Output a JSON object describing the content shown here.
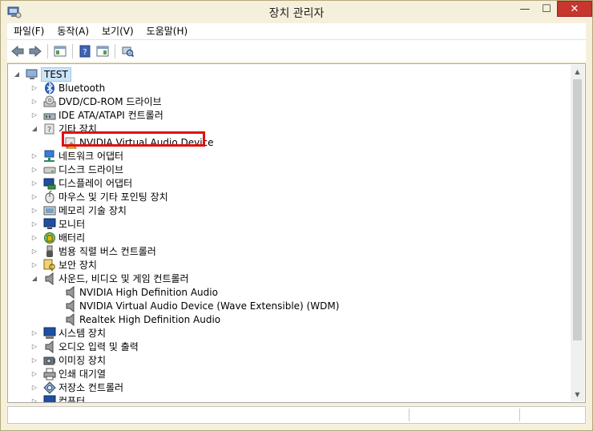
{
  "window": {
    "title": "장치 관리자",
    "controls": {
      "minimize": "—",
      "maximize": "☐",
      "close": "✕"
    }
  },
  "menu": [
    "파일(F)",
    "동작(A)",
    "보기(V)",
    "도움말(H)"
  ],
  "tree": {
    "root": "TEST",
    "items": [
      {
        "label": "Bluetooth",
        "icon": "bluetooth-icon",
        "expanded": false
      },
      {
        "label": "DVD/CD-ROM 드라이브",
        "icon": "disc-drive-icon",
        "expanded": false
      },
      {
        "label": "IDE ATA/ATAPI 컨트롤러",
        "icon": "ide-controller-icon",
        "expanded": false
      },
      {
        "label": "기타 장치",
        "icon": "unknown-device-icon",
        "expanded": true,
        "children": [
          {
            "label": "NVIDIA Virtual Audio Device",
            "icon": "warning-device-icon"
          }
        ]
      },
      {
        "label": "네트워크 어댑터",
        "icon": "network-adapter-icon",
        "expanded": false
      },
      {
        "label": "디스크 드라이브",
        "icon": "disk-drive-icon",
        "expanded": false
      },
      {
        "label": "디스플레이 어댑터",
        "icon": "display-adapter-icon",
        "expanded": false
      },
      {
        "label": "마우스 및 기타 포인팅 장치",
        "icon": "mouse-icon",
        "expanded": false
      },
      {
        "label": "메모리 기술 장치",
        "icon": "memory-icon",
        "expanded": false
      },
      {
        "label": "모니터",
        "icon": "monitor-icon",
        "expanded": false
      },
      {
        "label": "배터리",
        "icon": "battery-icon",
        "expanded": false
      },
      {
        "label": "범용 직렬 버스 컨트롤러",
        "icon": "usb-icon",
        "expanded": false
      },
      {
        "label": "보안 장치",
        "icon": "security-key-icon",
        "expanded": false
      },
      {
        "label": "사운드, 비디오 및 게임 컨트롤러",
        "icon": "speaker-icon",
        "expanded": true,
        "children": [
          {
            "label": "NVIDIA High Definition Audio",
            "icon": "speaker-icon"
          },
          {
            "label": "NVIDIA Virtual Audio Device (Wave Extensible) (WDM)",
            "icon": "speaker-icon"
          },
          {
            "label": "Realtek High Definition Audio",
            "icon": "speaker-icon"
          }
        ]
      },
      {
        "label": "시스템 장치",
        "icon": "system-device-icon",
        "expanded": false
      },
      {
        "label": "오디오 입력 및 출력",
        "icon": "audio-io-icon",
        "expanded": false
      },
      {
        "label": "이미징 장치",
        "icon": "camera-icon",
        "expanded": false
      },
      {
        "label": "인쇄 대기열",
        "icon": "printer-icon",
        "expanded": false
      },
      {
        "label": "저장소 컨트롤러",
        "icon": "storage-controller-icon",
        "expanded": false
      },
      {
        "label": "컴퓨터",
        "icon": "computer-icon",
        "expanded": false
      }
    ]
  },
  "colors": {
    "frame": "#f5f0dc",
    "close": "#c7372f",
    "highlight": "#e01010",
    "selection": "#cce4f7"
  }
}
